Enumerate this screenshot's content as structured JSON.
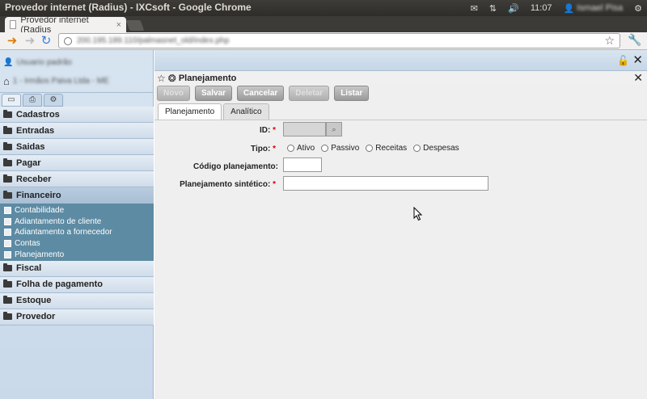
{
  "os": {
    "window_title": "Provedor internet (Radius) - IXCsoft - Google Chrome",
    "clock": "11:07",
    "user": "Ismael Pisa"
  },
  "browser": {
    "tab_title": "Provedor internet (Radius",
    "tab_close": "×",
    "url": "200.195.189.110/palmasnet_old/index.php"
  },
  "sidebar": {
    "user_name": "Usuario padrão",
    "company": "1 - Irmãos Paiva Ltda - ME",
    "menu": [
      {
        "label": "Cadastros"
      },
      {
        "label": "Entradas"
      },
      {
        "label": "Saidas"
      },
      {
        "label": "Pagar"
      },
      {
        "label": "Receber"
      },
      {
        "label": "Financeiro"
      },
      {
        "label": "Fiscal"
      },
      {
        "label": "Folha de pagamento"
      },
      {
        "label": "Estoque"
      },
      {
        "label": "Provedor"
      }
    ],
    "financeiro_sub": [
      {
        "label": "Contabilidade"
      },
      {
        "label": "Adiantamento de cliente"
      },
      {
        "label": "Adiantamento a fornecedor"
      },
      {
        "label": "Contas"
      },
      {
        "label": "Planejamento"
      }
    ]
  },
  "form": {
    "title": "Planejamento",
    "buttons": {
      "novo": "Novo",
      "salvar": "Salvar",
      "cancelar": "Cancelar",
      "deletar": "Deletar",
      "listar": "Listar"
    },
    "tabs": [
      {
        "label": "Planejamento"
      },
      {
        "label": "Analítico"
      }
    ],
    "fields": {
      "id_label": "ID:",
      "tipo_label": "Tipo:",
      "codigo_label": "Código planejamento:",
      "sintetico_label": "Planejamento sintético:"
    },
    "tipo_options": [
      {
        "label": "Ativo"
      },
      {
        "label": "Passivo"
      },
      {
        "label": "Receitas"
      },
      {
        "label": "Despesas"
      }
    ],
    "required_mark": "*"
  },
  "colors": {
    "accent_submenu": "#5d8ba3",
    "sidebar_bg": "#d7e4f0"
  }
}
